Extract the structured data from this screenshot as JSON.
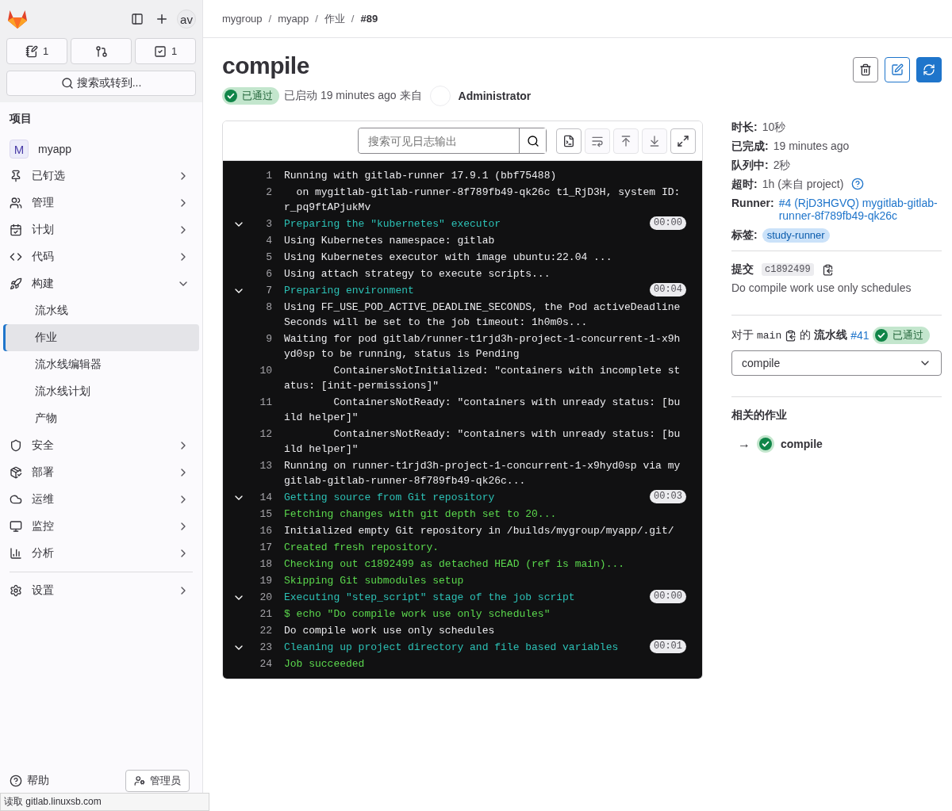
{
  "sidebar": {
    "avatar": "av",
    "counters": [
      {
        "kind": "issues",
        "count": "1"
      },
      {
        "kind": "merge"
      },
      {
        "kind": "todo",
        "count": "1"
      }
    ],
    "search_button": "搜索或转到...",
    "section_title": "项目",
    "project": {
      "initial": "M",
      "name": "myapp"
    },
    "nav": [
      {
        "label": "已钉选",
        "expanded": false
      },
      {
        "label": "管理",
        "expanded": false
      },
      {
        "label": "计划",
        "expanded": false
      },
      {
        "label": "代码",
        "expanded": false
      },
      {
        "label": "构建",
        "expanded": true,
        "children": [
          {
            "label": "流水线",
            "selected": false
          },
          {
            "label": "作业",
            "selected": true
          },
          {
            "label": "流水线编辑器",
            "selected": false
          },
          {
            "label": "流水线计划",
            "selected": false
          },
          {
            "label": "产物",
            "selected": false
          }
        ]
      },
      {
        "label": "安全",
        "expanded": false
      },
      {
        "label": "部署",
        "expanded": false
      },
      {
        "label": "运维",
        "expanded": false
      },
      {
        "label": "监控",
        "expanded": false
      },
      {
        "label": "分析",
        "expanded": false
      }
    ],
    "footer_nav": {
      "label": "设置",
      "expanded": false
    },
    "help": "帮助",
    "admin": "管理员"
  },
  "breadcrumbs": [
    "mygroup",
    "myapp",
    "作业",
    "#89"
  ],
  "breadcrumb_separator": "/",
  "job": {
    "title": "compile",
    "status": "已通过",
    "started": "已启动 19 minutes ago 来自",
    "user": "Administrator"
  },
  "log": {
    "search_placeholder": "搜索可见日志输出",
    "lines": [
      {
        "n": "1",
        "kind": "plain",
        "text": "Running with gitlab-runner 17.9.1 (bbf75488)"
      },
      {
        "n": "2",
        "kind": "plain",
        "text": "  on mygitlab-gitlab-runner-8f789fb49-qk26c t1_RjD3H, system ID: r_pq9ftAPjukMv"
      },
      {
        "n": "3",
        "kind": "section",
        "expanded": true,
        "text": "Preparing the \"kubernetes\" executor",
        "duration": "00:00"
      },
      {
        "n": "4",
        "kind": "plain",
        "text": "Using Kubernetes namespace: gitlab"
      },
      {
        "n": "5",
        "kind": "plain",
        "text": "Using Kubernetes executor with image ubuntu:22.04 ..."
      },
      {
        "n": "6",
        "kind": "plain",
        "text": "Using attach strategy to execute scripts..."
      },
      {
        "n": "7",
        "kind": "section",
        "expanded": true,
        "text": "Preparing environment",
        "duration": "00:04"
      },
      {
        "n": "8",
        "kind": "plain",
        "text": "Using FF_USE_POD_ACTIVE_DEADLINE_SECONDS, the Pod activeDeadlineSeconds will be set to the job timeout: 1h0m0s..."
      },
      {
        "n": "9",
        "kind": "plain",
        "text": "Waiting for pod gitlab/runner-t1rjd3h-project-1-concurrent-1-x9hyd0sp to be running, status is Pending"
      },
      {
        "n": "10",
        "kind": "plain",
        "text": "        ContainersNotInitialized: \"containers with incomplete status: [init-permissions]\""
      },
      {
        "n": "11",
        "kind": "plain",
        "text": "        ContainersNotReady: \"containers with unready status: [build helper]\""
      },
      {
        "n": "12",
        "kind": "plain",
        "text": "        ContainersNotReady: \"containers with unready status: [build helper]\""
      },
      {
        "n": "13",
        "kind": "plain",
        "text": "Running on runner-t1rjd3h-project-1-concurrent-1-x9hyd0sp via mygitlab-gitlab-runner-8f789fb49-qk26c..."
      },
      {
        "n": "14",
        "kind": "section",
        "expanded": true,
        "text": "Getting source from Git repository",
        "duration": "00:03"
      },
      {
        "n": "15",
        "kind": "success",
        "text": "Fetching changes with git depth set to 20..."
      },
      {
        "n": "16",
        "kind": "plain",
        "text": "Initialized empty Git repository in /builds/mygroup/myapp/.git/"
      },
      {
        "n": "17",
        "kind": "success",
        "text": "Created fresh repository."
      },
      {
        "n": "18",
        "kind": "success",
        "text": "Checking out c1892499 as detached HEAD (ref is main)..."
      },
      {
        "n": "19",
        "kind": "success",
        "text": "Skipping Git submodules setup"
      },
      {
        "n": "20",
        "kind": "section",
        "expanded": true,
        "text": "Executing \"step_script\" stage of the job script",
        "duration": "00:00"
      },
      {
        "n": "21",
        "kind": "success",
        "text": "$ echo \"Do compile work use only schedules\""
      },
      {
        "n": "22",
        "kind": "plain",
        "text": "Do compile work use only schedules"
      },
      {
        "n": "23",
        "kind": "section",
        "expanded": true,
        "text": "Cleaning up project directory and file based variables",
        "duration": "00:01"
      },
      {
        "n": "24",
        "kind": "success",
        "text": "Job succeeded"
      }
    ]
  },
  "details": [
    {
      "label": "时长:",
      "value": "10秒",
      "kind": "text"
    },
    {
      "label": "已完成:",
      "value": "19 minutes ago",
      "kind": "text"
    },
    {
      "label": "队列中:",
      "value": "2秒",
      "kind": "text"
    },
    {
      "label": "超时:",
      "value": "1h (来自 project)",
      "kind": "help"
    },
    {
      "label": "Runner:",
      "value": "#4 (RjD3HGVQ) mygitlab-gitlab-runner-8f789fb49-qk26c",
      "kind": "link"
    }
  ],
  "tags": {
    "label": "标签:",
    "items": [
      "study-runner"
    ]
  },
  "commit": {
    "label": "提交",
    "sha": "c1892499",
    "message": "Do compile work use only schedules"
  },
  "pipeline": {
    "prefix": "对于",
    "ref": "main",
    "middle": "的",
    "label": "流水线",
    "id": "#41",
    "status": "已通过"
  },
  "job_select": "compile",
  "related": {
    "title": "相关的作业",
    "jobs": [
      {
        "arrow": "→",
        "name": "compile"
      }
    ]
  },
  "status_bar": "读取 gitlab.linuxsb.com"
}
